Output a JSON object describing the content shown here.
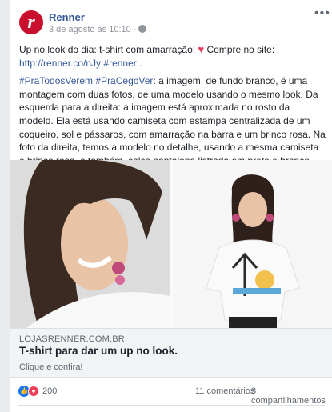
{
  "post": {
    "page_name": "Renner",
    "avatar_letter": "r",
    "meta": "3 de agosto às 10:10 ·",
    "more": "•••"
  },
  "text": {
    "line1_a": "Up no look do dia: t-shirt com amarração! ",
    "line1_b": " Compre no site: ",
    "link": "http://renner.co/nJy",
    "hashtag_renner": " #renner",
    "end": " .",
    "hashtags": "#PraTodosVerem #PraCegoVer",
    "desc": ": a imagem, de fundo branco, é uma montagem com duas fotos, de uma modelo usando o mesmo look. Da esquerda para a direita: a imagem está aproximada no rosto da modelo. Ela está usando camiseta com estampa centralizada de um coqueiro, sol e pássaros, com amarração na barra e um brinco rosa. Na foto da direita, temos a modelo no detalhe, usando a mesma camiseta e brinco rosa, e também, calça pantalona listrada em preto e branco com babados."
  },
  "preview": {
    "domain": "LOJASRENNER.COM.BR",
    "title": "T-shirt para dar um up no look.",
    "subtitle": "Clique e confira!"
  },
  "stats": {
    "reactions": "200",
    "comments": "11 comentários",
    "shares": "3 compartilhamentos"
  },
  "colors": {
    "brand": "#c8102e",
    "link": "#365899"
  }
}
